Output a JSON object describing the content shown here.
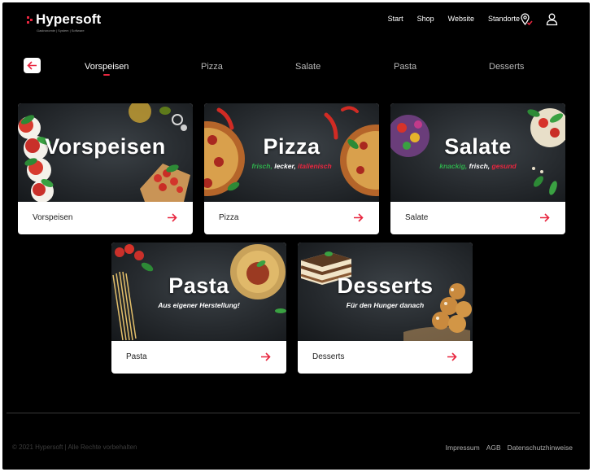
{
  "brand": {
    "name": "Hypersoft",
    "tagline": "Gastronomie | System | Software",
    "accent_color": "#e8263f"
  },
  "header": {
    "nav": [
      "Start",
      "Shop",
      "Website",
      "Standorte"
    ],
    "icons": [
      "location-pin-icon",
      "user-icon"
    ]
  },
  "categories": {
    "back_icon": "arrow-left-icon",
    "tabs": [
      {
        "label": "Vorspeisen",
        "active": true
      },
      {
        "label": "Pizza",
        "active": false
      },
      {
        "label": "Salate",
        "active": false
      },
      {
        "label": "Pasta",
        "active": false
      },
      {
        "label": "Desserts",
        "active": false
      }
    ]
  },
  "cards": [
    {
      "image_title": "Vorspeisen",
      "image_subtitle": "",
      "label": "Vorspeisen"
    },
    {
      "image_title": "Pizza",
      "image_subtitle": [
        "frisch,",
        "lecker,",
        "italienisch"
      ],
      "label": "Pizza"
    },
    {
      "image_title": "Salate",
      "image_subtitle": [
        "knackig,",
        "frisch,",
        "gesund"
      ],
      "label": "Salate"
    },
    {
      "image_title": "Pasta",
      "image_subtitle": "Aus eigener Herstellung!",
      "label": "Pasta"
    },
    {
      "image_title": "Desserts",
      "image_subtitle": "Für den Hunger danach",
      "label": "Desserts"
    }
  ],
  "card_arrow_icon": "arrow-right-icon",
  "subtitle_colors": {
    "green": "#2fae4c",
    "white": "#ffffff",
    "red": "#e8263f"
  },
  "footer": {
    "copyright": "© 2021 Hypersoft | Alle Rechte vorbehalten",
    "links": [
      "Impressum",
      "AGB",
      "Datenschutzhinweise"
    ]
  }
}
